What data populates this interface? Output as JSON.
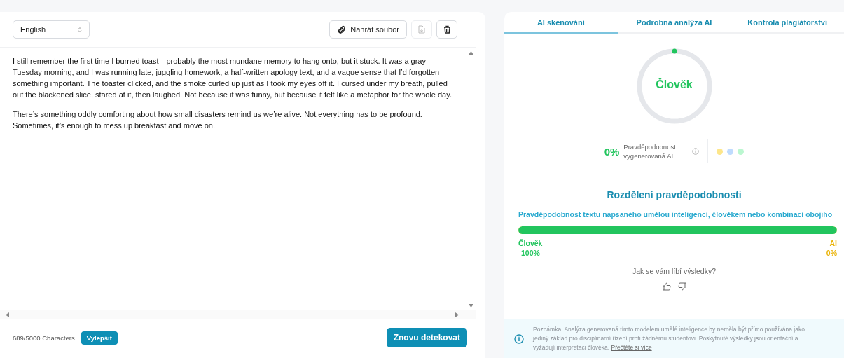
{
  "editor": {
    "language": "English",
    "upload_button": "Nahrát soubor",
    "paragraphs": [
      "I still remember the first time I burned toast—probably the most mundane memory to hang onto, but it stuck. It was a gray Tuesday morning, and I was running late, juggling homework, a half-written apology text, and a vague sense that I’d forgotten something important. The toaster clicked, and the smoke curled up just as I took my eyes off it. I cursed under my breath, pulled out the blackened slice, stared at it, then laughed. Not because it was funny, but because it felt like a metaphor for the whole day.",
      "There’s something oddly comforting about how small disasters remind us we’re alive. Not everything has to be profound. Sometimes, it’s enough to mess up breakfast and move on."
    ],
    "char_count": "689/5000 Characters",
    "improve_button": "Vylepšit",
    "detect_button": "Znovu detekovat"
  },
  "results": {
    "tabs": [
      {
        "label": "AI skenování",
        "selected": true
      },
      {
        "label": "Podrobná analýza AI",
        "selected": false
      },
      {
        "label": "Kontrola plagiátorství",
        "selected": false
      }
    ],
    "gauge": {
      "label": "Člověk"
    },
    "ai_score": {
      "value": "0%",
      "caption": "Pravděpodobnost vygenerovaná AI"
    },
    "legend": [
      {
        "color": "#fde68a"
      },
      {
        "color": "#bfdbfe"
      },
      {
        "color": "#bbf7d0"
      }
    ],
    "distribution": {
      "title": "Rozdělení pravděpodobnosti",
      "subtitle": "Pravděpodobnost textu napsaného umělou inteligencí, člověkem nebo kombinací obojího",
      "level": 1,
      "human_label": "Člověk",
      "human_value": "100%",
      "ai_label": "AI",
      "ai_value": "0%"
    },
    "feedback_question": "Jak se vám líbí výsledky?",
    "note": {
      "text": "Poznámka: Analýza generovaná tímto modelem umělé inteligence by neměla být přímo používána jako jediný základ pro disciplinární řízení proti žádnému studentovi. Poskytnuté výsledky jsou orientační a vyžadují interpretaci člověka.",
      "link": "Přečtěte si více"
    }
  }
}
